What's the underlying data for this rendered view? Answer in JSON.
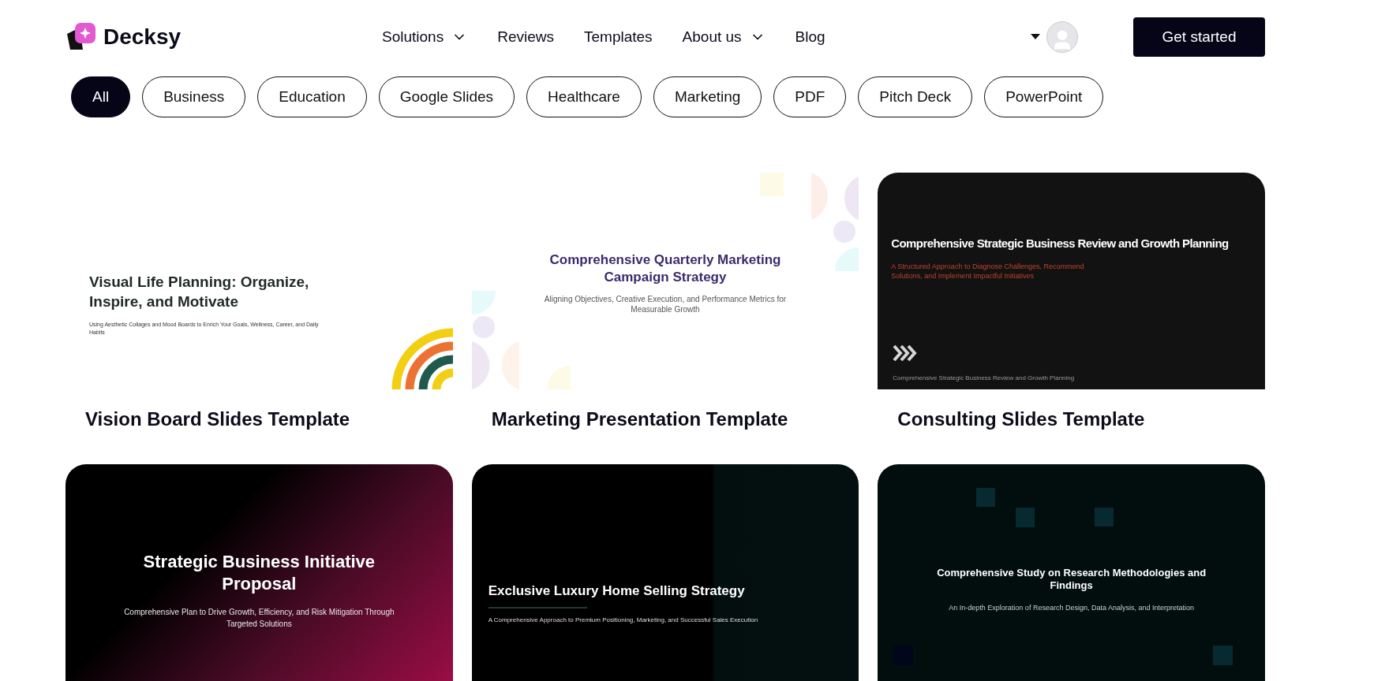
{
  "brand": {
    "name": "Decksy"
  },
  "nav": [
    {
      "label": "Solutions",
      "has_menu": true
    },
    {
      "label": "Reviews",
      "has_menu": false
    },
    {
      "label": "Templates",
      "has_menu": false
    },
    {
      "label": "About us",
      "has_menu": true
    },
    {
      "label": "Blog",
      "has_menu": false
    }
  ],
  "cta": {
    "label": "Get started"
  },
  "filters": [
    {
      "label": "All",
      "selected": true
    },
    {
      "label": "Business",
      "selected": false
    },
    {
      "label": "Education",
      "selected": false
    },
    {
      "label": "Google Slides",
      "selected": false
    },
    {
      "label": "Healthcare",
      "selected": false
    },
    {
      "label": "Marketing",
      "selected": false
    },
    {
      "label": "PDF",
      "selected": false
    },
    {
      "label": "Pitch Deck",
      "selected": false
    },
    {
      "label": "PowerPoint",
      "selected": false
    }
  ],
  "templates": [
    {
      "kind": "vision",
      "slide_title": "Visual Life Planning: Organize, Inspire, and Motivate",
      "slide_subtitle": "Using Aesthetic Collages and Mood Boards to Enrich Your Goals, Wellness, Career, and Daily Habits",
      "title": "Vision Board Slides Template"
    },
    {
      "kind": "marketing",
      "slide_title": "Comprehensive Quarterly Marketing Campaign Strategy",
      "slide_subtitle": "Aligning Objectives, Creative Execution, and Performance Metrics for Measurable Growth",
      "title": "Marketing Presentation Template"
    },
    {
      "kind": "consulting",
      "slide_title": "Comprehensive Strategic Business Review and Growth Planning",
      "slide_subtitle": "A Structured Approach to Diagnose Challenges, Recommend Solutions, and Implement Impactful Initiatives",
      "slide_footer": "Comprehensive Strategic Business Review and Growth Planning",
      "title": "Consulting Slides Template"
    },
    {
      "kind": "proposal",
      "slide_title": "Strategic Business Initiative Proposal",
      "slide_subtitle": "Comprehensive Plan to Drive Growth, Efficiency, and Risk Mitigation Through Targeted Solutions"
    },
    {
      "kind": "luxury",
      "slide_title": "Exclusive Luxury Home Selling Strategy",
      "slide_subtitle": "A Comprehensive Approach to Premium Positioning, Marketing, and Successful Sales Execution"
    },
    {
      "kind": "research",
      "slide_title": "Comprehensive Study on Research Methodologies and Findings",
      "slide_subtitle": "An In-depth Exploration of Research Design, Data Analysis, and Interpretation"
    }
  ]
}
